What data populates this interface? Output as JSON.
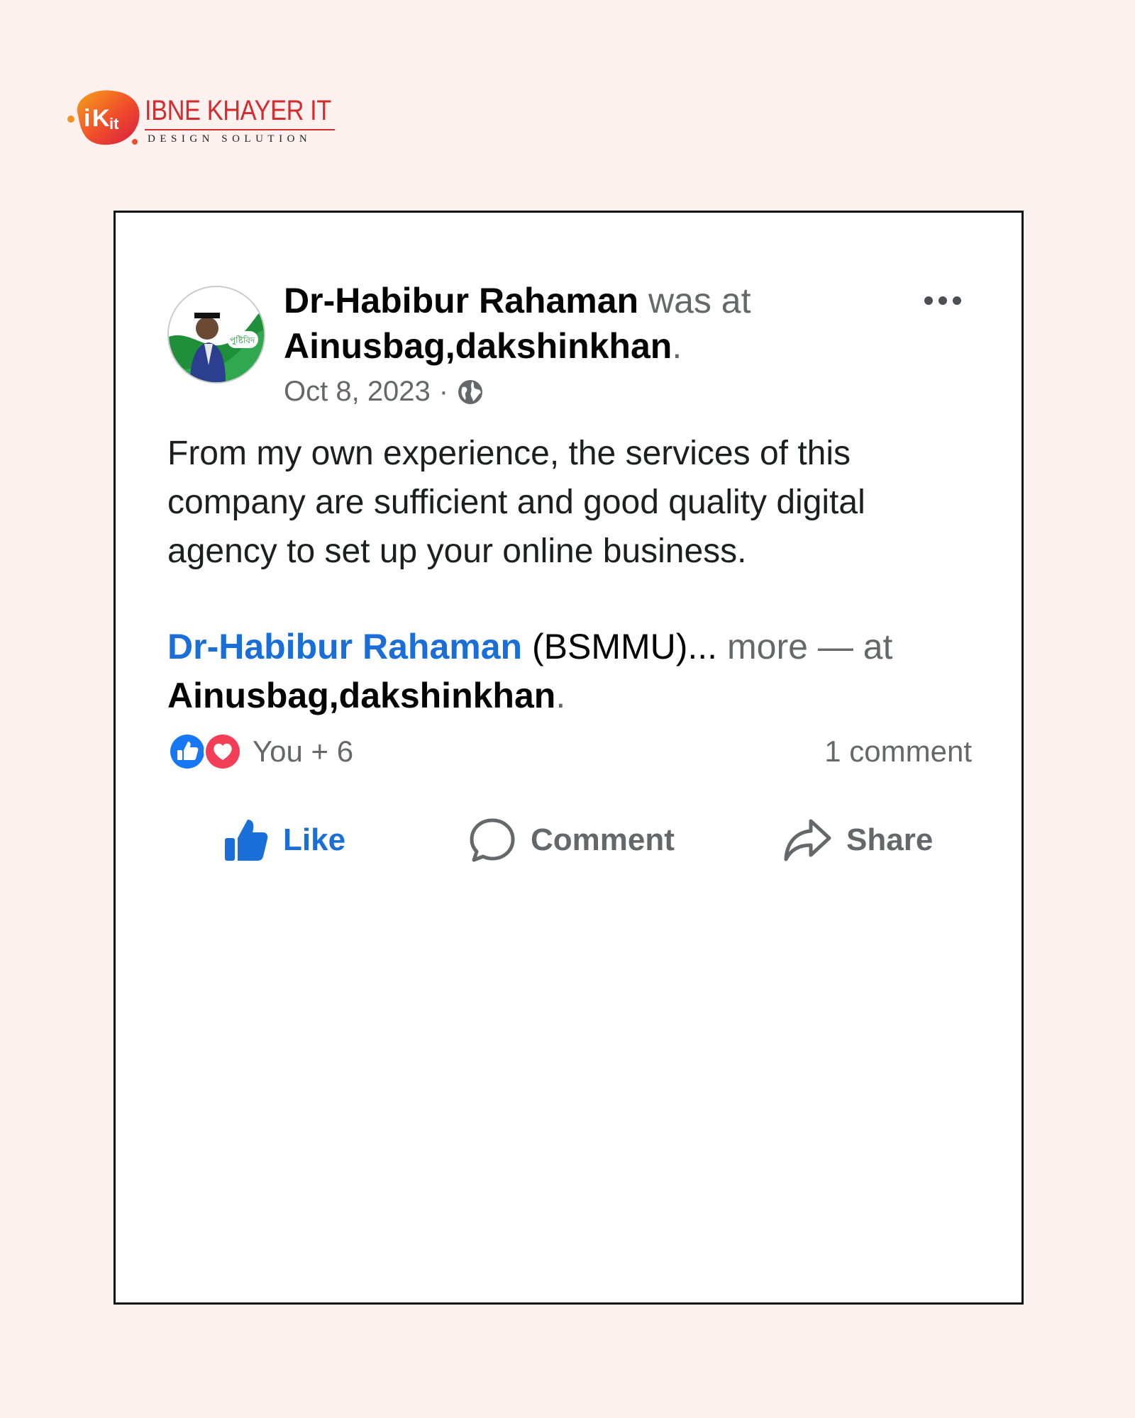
{
  "brand": {
    "name": "IBNE KHAYER IT",
    "tagline": "DESIGN SOLUTION",
    "logo_mark": "iKit",
    "colors": {
      "primary": "#d52b2f",
      "secondary": "#f7931e"
    }
  },
  "post": {
    "author": "Dr-Habibur Rahaman",
    "header_connector": "was at",
    "location": "Ainusbag,dakshinkhan",
    "period": ".",
    "date": "Oct 8, 2023",
    "date_separator": "·",
    "privacy_icon": "globe-icon",
    "avatar_badge": "পুষ্টিবিদ",
    "body": "From my own experience, the services of this company are sufficient and good quality digital agency to set up your online business.",
    "mention": {
      "name": "Dr-Habibur Rahaman",
      "affiliation": "(BSMMU)...",
      "more": "more",
      "dash_at": "— at",
      "location": "Ainusbag,dakshinkhan",
      "period": "."
    },
    "reactions": {
      "icons": [
        "like-reaction-icon",
        "love-reaction-icon"
      ],
      "summary": "You + 6"
    },
    "comment_count": "1 comment",
    "actions": {
      "like": "Like",
      "comment": "Comment",
      "share": "Share"
    },
    "colors": {
      "link": "#1a6ed8",
      "muted": "#65676b",
      "text": "#050505"
    }
  }
}
